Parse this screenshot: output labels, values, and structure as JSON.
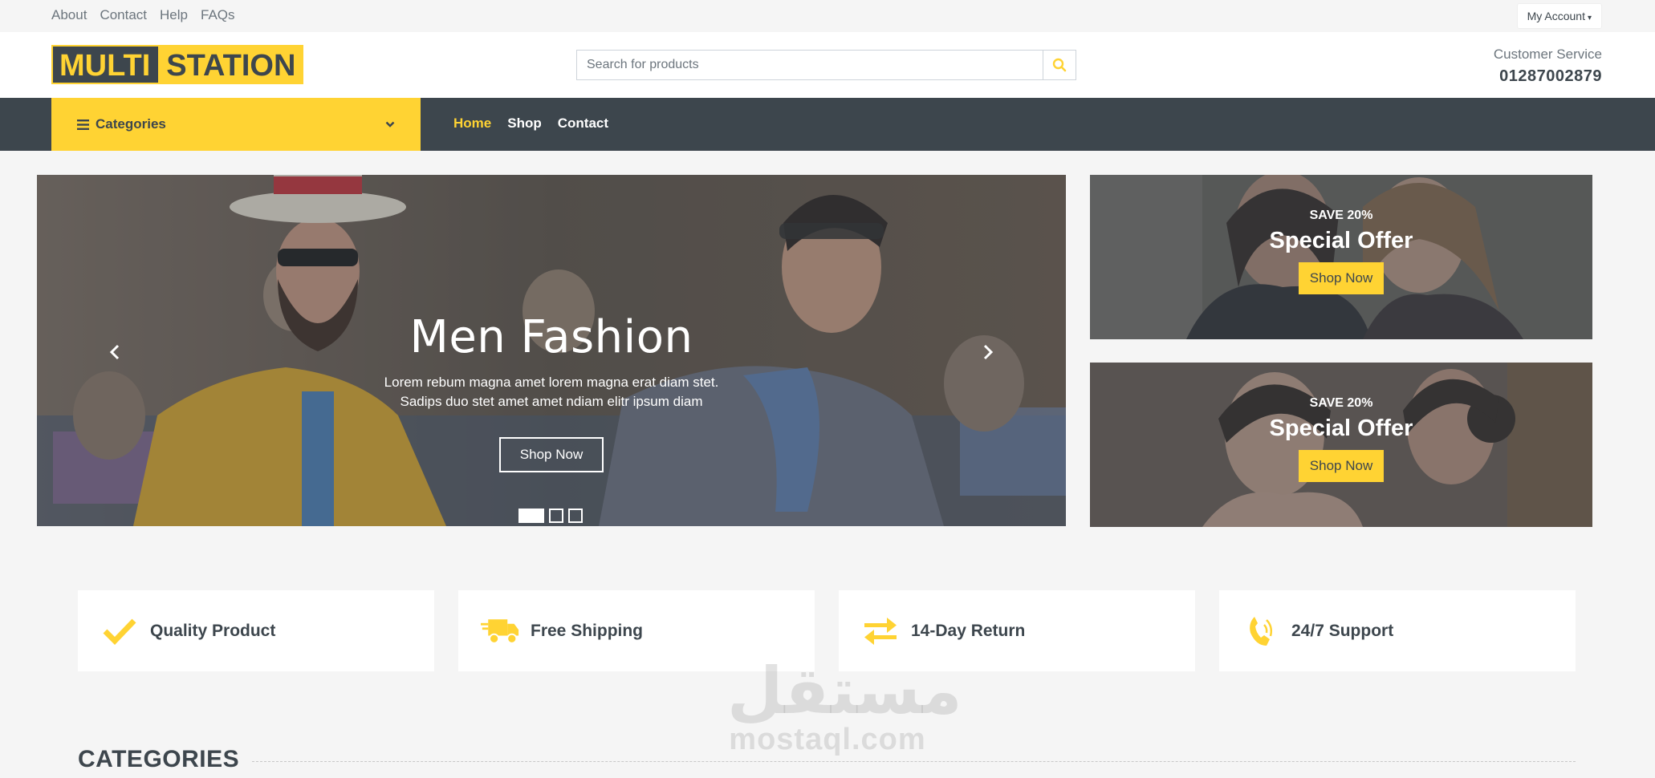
{
  "topbar": {
    "links": [
      "About",
      "Contact",
      "Help",
      "FAQs"
    ],
    "account_label": "My Account"
  },
  "header": {
    "logo_part1": "MULTI",
    "logo_part2": "STATION",
    "search_placeholder": "Search for products",
    "cs_label": "Customer Service",
    "cs_phone": "01287002879"
  },
  "nav": {
    "categories_label": "Categories",
    "links": [
      "Home",
      "Shop",
      "Contact"
    ],
    "active_index": 0
  },
  "carousel": {
    "title": "Men Fashion",
    "text": "Lorem rebum magna amet lorem magna erat diam stet. Sadips duo stet amet amet ndiam elitr ipsum diam",
    "button": "Shop Now",
    "slides": 3,
    "active_slide": 0
  },
  "offers": [
    {
      "save": "SAVE 20%",
      "title": "Special Offer",
      "button": "Shop Now"
    },
    {
      "save": "SAVE 20%",
      "title": "Special Offer",
      "button": "Shop Now"
    }
  ],
  "features": [
    {
      "icon": "check-icon",
      "label": "Quality Product"
    },
    {
      "icon": "shipping-fast-icon",
      "label": "Free Shipping"
    },
    {
      "icon": "exchange-arrows-icon",
      "label": "14-Day Return"
    },
    {
      "icon": "phone-volume-icon",
      "label": "24/7 Support"
    }
  ],
  "watermark": {
    "arabic": "مستقل",
    "latin": "mostaql.com"
  },
  "sections": {
    "categories_title": "CATEGORIES"
  },
  "colors": {
    "primary": "#ffd333",
    "dark": "#3d464d",
    "background": "#f5f5f5"
  }
}
